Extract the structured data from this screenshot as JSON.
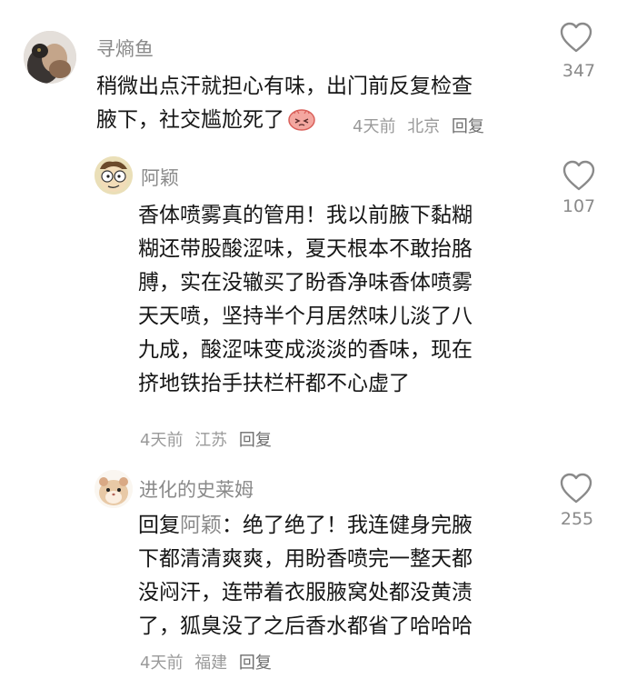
{
  "comments": [
    {
      "username": "寻熵鱼",
      "lines": [
        "稍微出点汗就担心有味，出门前反复检查",
        "腋下，社交尴尬死了"
      ],
      "emoji": "sweat-face-emoji",
      "time": "4天前",
      "location": "北京",
      "reply_label": "回复",
      "likes": "347",
      "avatar": "cat-avatar"
    },
    {
      "username": "阿颖",
      "lines": [
        "香体喷雾真的管用！我以前腋下黏糊",
        "糊还带股酸涩味，夏天根本不敢抬胳",
        "膊，实在没辙买了盼香净味香体喷雾",
        "天天喷，坚持半个月居然味儿淡了八",
        "九成，酸涩味变成淡淡的香味，现在",
        "挤地铁抬手扶栏杆都不心虚了"
      ],
      "time": "4天前",
      "location": "江苏",
      "reply_label": "回复",
      "likes": "107",
      "avatar": "cartoon-avatar"
    },
    {
      "username": "进化的史莱姆",
      "reply_prefix": "回复",
      "mention": "阿颖",
      "first_line_rest": "：绝了绝了！我连健身完腋",
      "lines": [
        "下都清清爽爽，用盼香喷完一整天都",
        "没闷汗，连带着衣服腋窝处都没黄渍",
        "了，狐臭没了之后香水都省了哈哈哈"
      ],
      "time": "4天前",
      "location": "福建",
      "reply_label": "回复",
      "likes": "255",
      "avatar": "hamster-avatar"
    }
  ],
  "colors": {
    "text": "#161616",
    "username": "#8a8a8a",
    "meta": "#9a9a9a"
  }
}
